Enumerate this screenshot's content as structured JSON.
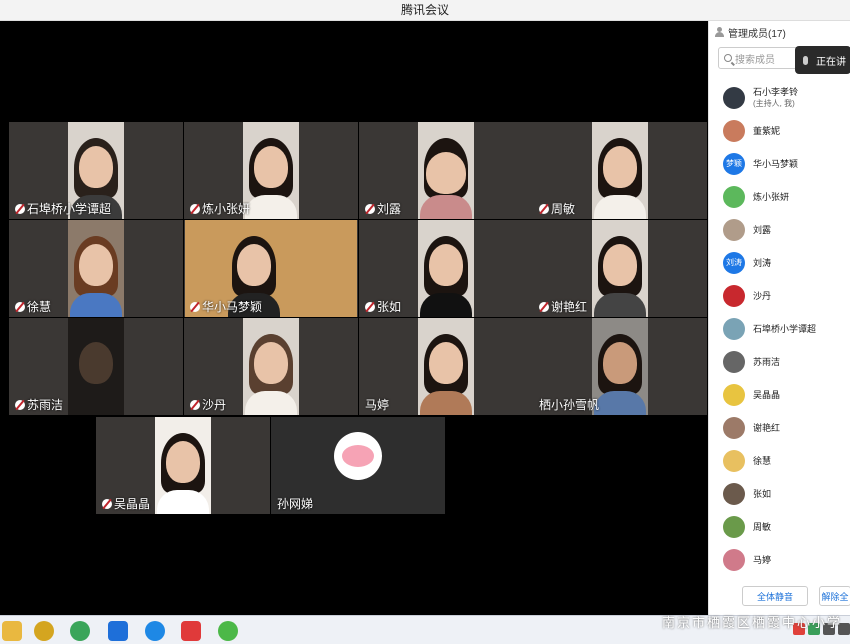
{
  "window": {
    "title": "腾讯会议"
  },
  "tiles": [
    {
      "name": "石埠桥小学谭超",
      "muted": true
    },
    {
      "name": "炼小张妍",
      "muted": true
    },
    {
      "name": "刘露",
      "muted": true
    },
    {
      "name": "周敏",
      "muted": true
    },
    {
      "name": "徐慧",
      "muted": true
    },
    {
      "name": "华小马梦颖",
      "muted": true
    },
    {
      "name": "张如",
      "muted": true
    },
    {
      "name": "谢艳红",
      "muted": true
    },
    {
      "name": "苏雨洁",
      "muted": true
    },
    {
      "name": "沙丹",
      "muted": true
    },
    {
      "name": "马婷",
      "muted": false
    },
    {
      "name": "栖小孙雪帆",
      "muted": false
    },
    {
      "name": "吴晶晶",
      "muted": true
    },
    {
      "name": "孙网娣",
      "muted": false
    }
  ],
  "panel": {
    "title": "管理成员(17)",
    "search_placeholder": "搜索成员",
    "speaking_label": "正在讲",
    "members": [
      {
        "name": "石小李孝铃",
        "sub": "(主持人, 我)",
        "avatar_color": "#333a44",
        "avatar_text": ""
      },
      {
        "name": "董紫妮",
        "sub": "",
        "avatar_color": "#c97b5d",
        "avatar_text": ""
      },
      {
        "name": "华小马梦颖",
        "sub": "",
        "avatar_color": "#1e78e6",
        "avatar_text": "梦颖"
      },
      {
        "name": "炼小张妍",
        "sub": "",
        "avatar_color": "#5cb85c",
        "avatar_text": ""
      },
      {
        "name": "刘露",
        "sub": "",
        "avatar_color": "#b09c8a",
        "avatar_text": ""
      },
      {
        "name": "刘涛",
        "sub": "",
        "avatar_color": "#1e78e6",
        "avatar_text": "刘涛"
      },
      {
        "name": "沙丹",
        "sub": "",
        "avatar_color": "#c8282e",
        "avatar_text": ""
      },
      {
        "name": "石埠桥小学谭超",
        "sub": "",
        "avatar_color": "#7aa3b5",
        "avatar_text": ""
      },
      {
        "name": "苏雨洁",
        "sub": "",
        "avatar_color": "#666666",
        "avatar_text": ""
      },
      {
        "name": "吴晶晶",
        "sub": "",
        "avatar_color": "#e8c440",
        "avatar_text": ""
      },
      {
        "name": "谢艳红",
        "sub": "",
        "avatar_color": "#9c7a68",
        "avatar_text": ""
      },
      {
        "name": "徐慧",
        "sub": "",
        "avatar_color": "#e8c060",
        "avatar_text": ""
      },
      {
        "name": "张如",
        "sub": "",
        "avatar_color": "#6b5a4c",
        "avatar_text": ""
      },
      {
        "name": "周敏",
        "sub": "",
        "avatar_color": "#6a9a4a",
        "avatar_text": ""
      },
      {
        "name": "马婷",
        "sub": "",
        "avatar_color": "#d07a8a",
        "avatar_text": ""
      }
    ],
    "mute_all_label": "全体静音",
    "unmute_all_label": "解除全"
  },
  "watermark": "南京市栖霞区栖霞中心小学"
}
